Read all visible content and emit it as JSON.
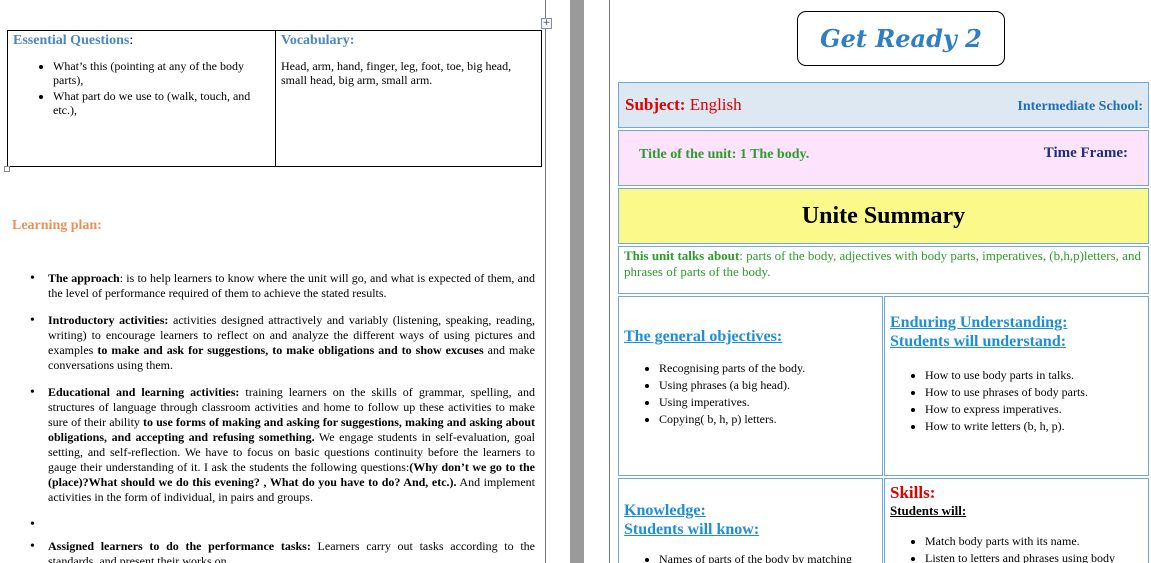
{
  "left": {
    "essential": {
      "heading": "Essential Questions",
      "heading_suffix": ":",
      "items": [
        "What’s this (pointing at any of the body parts),",
        "What part do we use to (walk, touch, and etc.),"
      ]
    },
    "vocabulary": {
      "heading": "Vocabulary:",
      "text": "Head, arm, hand, finger, leg, foot, toe, big head, small head, big arm, small arm."
    },
    "learning_plan": "Learning plan:",
    "plan": {
      "approach_label": "The approach",
      "approach_text": ": is to help learners to know where the unit will go, and what is expected of them, and the level of performance required of them to achieve the stated results.",
      "intro_label": "Introductory activities:",
      "intro_text": " activities designed attractively and variably (listening, speaking, reading, writing) to encourage learners to reflect on and analyze the different ways of using pictures and examples ",
      "intro_bold": "to make and ask for suggestions, to make obligations and to show excuses",
      "intro_tail": " and make conversations using them.",
      "edu_label": "Educational and learning activities:",
      "edu_text1": " training learners on the skills of grammar, spelling, and structures of language through classroom activities and home to follow up these activities to make sure of their ability ",
      "edu_bold1": "to use forms of making and asking for suggestions, making and asking about obligations, and accepting and refusing something.",
      "edu_text2": " We engage students in self-evaluation, goal setting, and self-reflection. We have to focus on basic questions continuity before the learners to gauge their understanding of it. I ask the students the following questions:",
      "edu_bold2": "(Why don’t we go to the (place)?What should we do this evening? , What do you have to do? And, etc.).",
      "edu_text3": " And implement activities in the form of individual, in pairs and groups.",
      "assigned_label": "Assigned learners to do the performance tasks:",
      "assigned_text": " Learners carry out tasks according to the standards, and present their works on."
    },
    "move_handle_glyph": "+"
  },
  "right": {
    "book_title": "Get Ready 2",
    "subject_label": "Subject:",
    "subject_value": " English",
    "school": "Intermediate School:",
    "unit_title": "Title of the unit:   1   The body.",
    "time_frame": "Time Frame:",
    "summary": "Unite Summary",
    "talks_label": "This unit talks about",
    "talks_text": ": parts of the body, adjectives with body parts, imperatives, (b,h,p)letters, and phrases of parts of the body.",
    "objectives": {
      "heading": "The general objectives:",
      "items": [
        "Recognising parts of the body.",
        "Using phrases (a big head).",
        "Using imperatives.",
        "Copying( b, h, p) letters."
      ]
    },
    "enduring": {
      "heading1": "Enduring Understanding:",
      "heading2": "Students will understand:",
      "items": [
        "How to use body parts in talks.",
        "How to use phrases of body parts.",
        "How to express imperatives.",
        "How to write letters  (b, h, p)."
      ]
    },
    "knowledge": {
      "heading1": "Knowledge:",
      "heading2": "Students will know:",
      "items": [
        "Names of parts of the body by matching"
      ]
    },
    "skills": {
      "heading": "Skills:",
      "subheading": "Students will:",
      "items": [
        "Match body parts with its name.",
        "Listen to letters  and phrases using body"
      ]
    }
  }
}
